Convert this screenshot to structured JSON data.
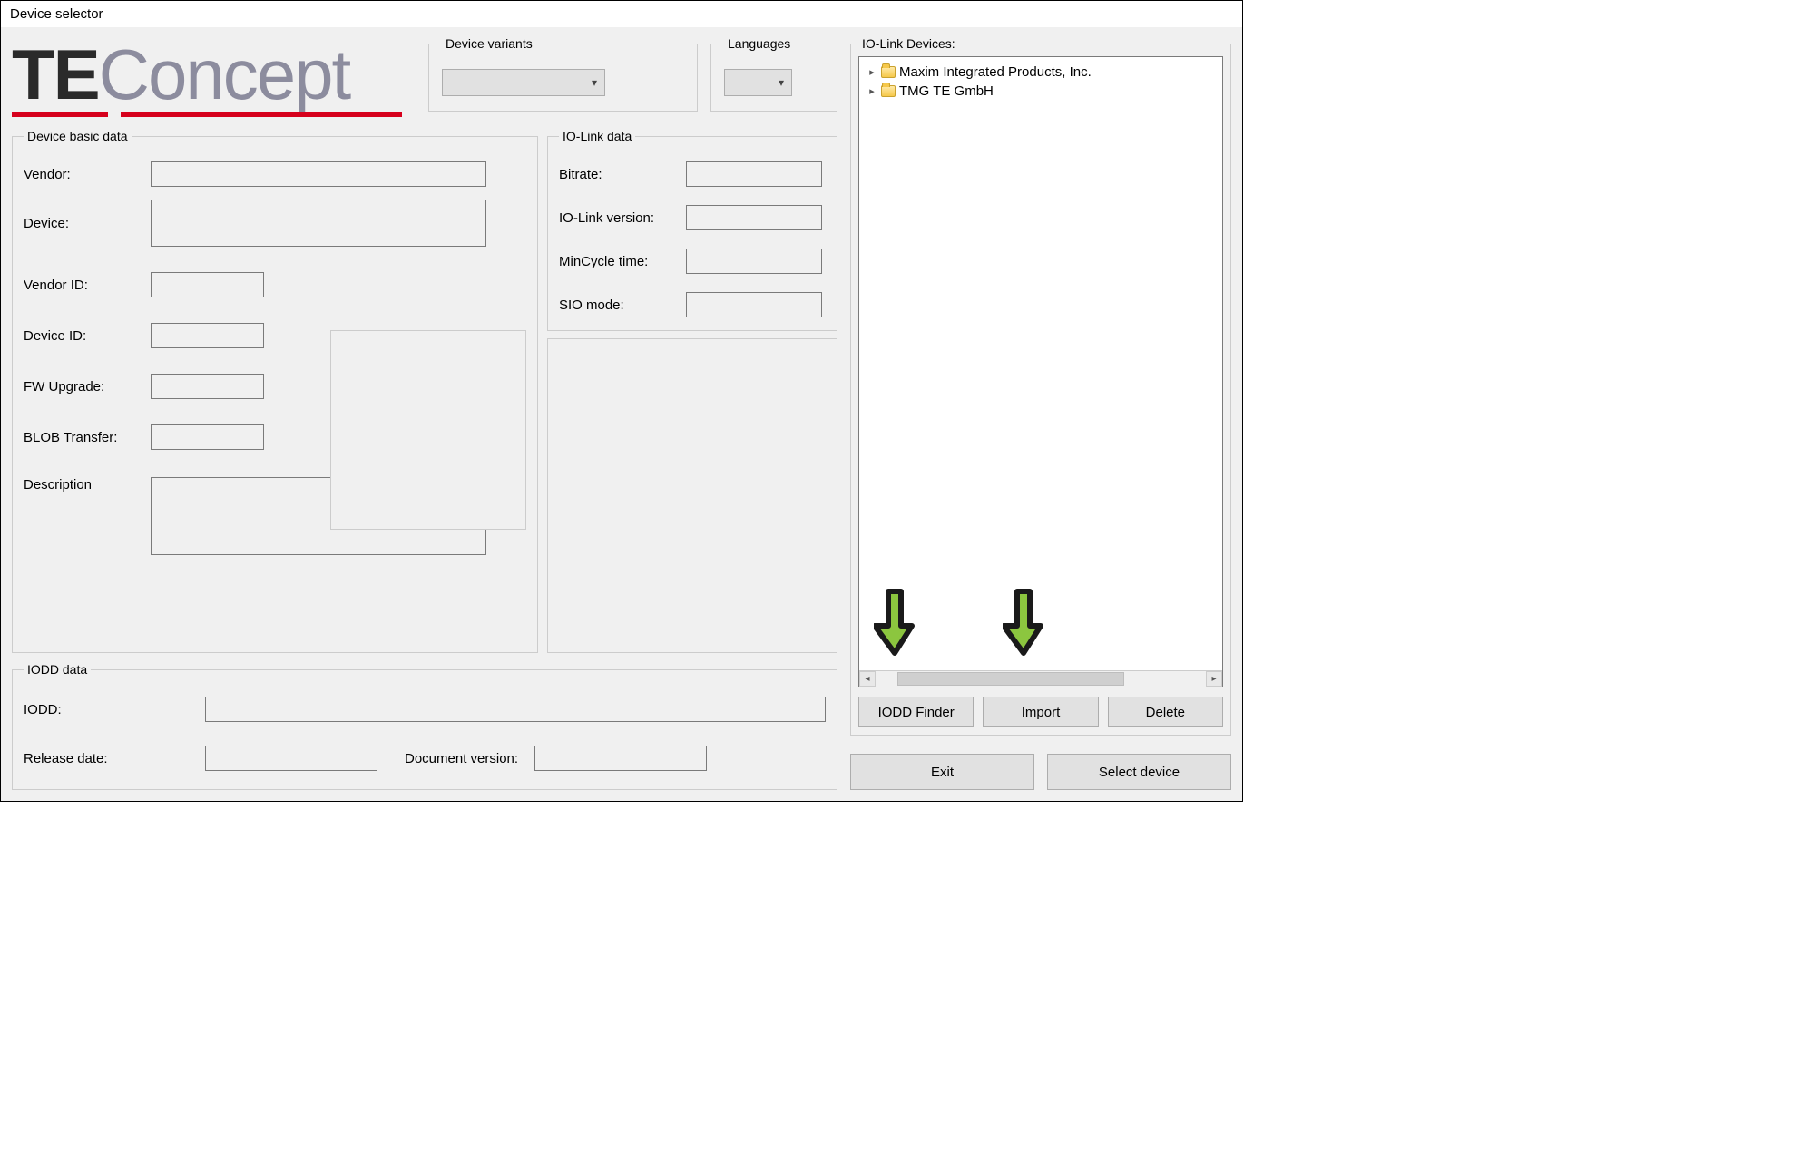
{
  "window_title": "Device selector",
  "device_variants": {
    "legend": "Device variants",
    "selected": ""
  },
  "languages": {
    "legend": "Languages",
    "selected": ""
  },
  "basic_data": {
    "legend": "Device basic data",
    "labels": {
      "vendor": "Vendor:",
      "device": "Device:",
      "vendor_id": "Vendor ID:",
      "device_id": "Device ID:",
      "fw_upgrade": "FW Upgrade:",
      "blob_transfer": "BLOB Transfer:",
      "description": "Description"
    },
    "values": {
      "vendor": "",
      "device": "",
      "vendor_id": "",
      "device_id": "",
      "fw_upgrade": "",
      "blob_transfer": "",
      "description": ""
    }
  },
  "io_link_data": {
    "legend": "IO-Link data",
    "labels": {
      "bitrate": "Bitrate:",
      "version": "IO-Link version:",
      "mincycle": "MinCycle time:",
      "sio": "SIO mode:"
    },
    "values": {
      "bitrate": "",
      "version": "",
      "mincycle": "",
      "sio": ""
    }
  },
  "iodd_data": {
    "legend": "IODD data",
    "labels": {
      "iodd": "IODD:",
      "release": "Release date:",
      "docver": "Document version:"
    },
    "values": {
      "iodd": "",
      "release": "",
      "docver": ""
    }
  },
  "devices_panel": {
    "legend": "IO-Link Devices:",
    "items": [
      "Maxim Integrated Products, Inc.",
      "TMG TE GmbH"
    ]
  },
  "buttons": {
    "iodd_finder": "IODD Finder",
    "import": "Import",
    "delete": "Delete",
    "exit": "Exit",
    "select_device": "Select device"
  },
  "logo": {
    "part1": "TE",
    "part2": "Concept"
  }
}
